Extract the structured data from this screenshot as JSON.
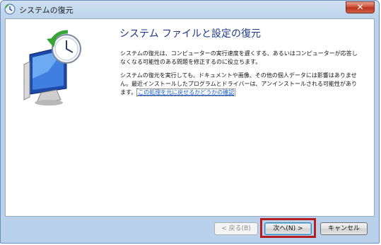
{
  "window": {
    "title": "システムの復元"
  },
  "main": {
    "heading": "システム ファイルと設定の復元",
    "paragraph1": "システムの復元は、コンピューターの実行速度を遅くする、あるいはコンピューターが応答しなくなる可能性のある問題を修正するのに役立ちます。",
    "paragraph2": "システムの復元を実行しても、ドキュメントや画像、その他の個人データには影響はありません。最近インストールしたプログラムとドライバーは、アンインストールされる可能性があります。",
    "link": "この処理を元に戻せるかどうかの確認"
  },
  "buttons": {
    "back": "< 戻る(B)",
    "next": "次へ(N) >",
    "cancel": "キャンセル"
  },
  "icons": {
    "title": "system-restore-icon",
    "hero": "system-restore-clock-monitor-icon",
    "close": "close-icon"
  },
  "colors": {
    "heading": "#1f3b8a",
    "link": "#1a5fd6",
    "highlight": "#b51f1f",
    "close": "#c9462c"
  }
}
